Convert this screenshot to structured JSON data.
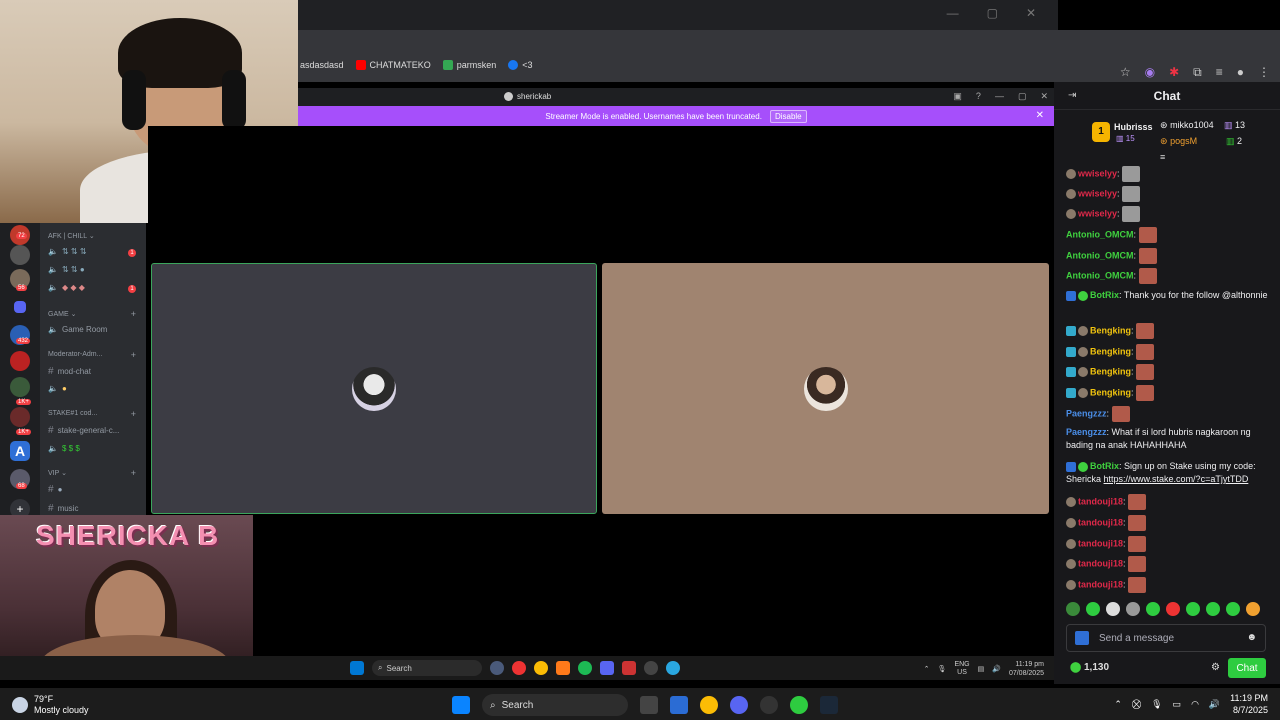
{
  "bookmarks": [
    {
      "label": "asdasdasd",
      "color": "#35363a"
    },
    {
      "label": "CHATMATEKO",
      "color": "#ff0000"
    },
    {
      "label": "parmsken",
      "color": "#34a853"
    },
    {
      "label": "<3",
      "color": "#1877f2"
    }
  ],
  "discord": {
    "window_title": "sherickab",
    "streamer_mode_text": "Streamer Mode is enabled. Usernames have been truncated.",
    "disable_label": "Disable",
    "categories": {
      "afk": "AFK | CHILL",
      "game": "GAME",
      "moderator": "Moderator-Adm...",
      "stake": "STAKE#1",
      "vip": "VIP"
    },
    "channels": {
      "game_room": "Game Room",
      "mod_chat": "mod-chat",
      "stake_general": "stake-general-c...",
      "music": "music"
    },
    "guild_badges": [
      "72",
      "56",
      "432",
      "1K+",
      "1K+",
      "68"
    ]
  },
  "overlay_name": "SHERICKA B",
  "inner_taskbar": {
    "search_label": "Search",
    "lang": "ENG",
    "region": "US",
    "time": "11:19 pm",
    "date": "07/08/2025"
  },
  "chat": {
    "title": "Chat",
    "leaderboard": {
      "rank": "1",
      "top_user": "Hubrisss",
      "top_count": "15",
      "second_user": "mikko1004",
      "second_count": "13",
      "third_user": "pogsM",
      "third_count": "2"
    },
    "messages": [
      {
        "user": "wwiselyy",
        "text": ":",
        "color": "#e0294a"
      },
      {
        "user": "wwiselyy",
        "text": ":",
        "color": "#e0294a"
      },
      {
        "user": "wwiselyy",
        "text": ":",
        "color": "#e0294a"
      },
      {
        "user": "Antonio_OMCM",
        "text": ":",
        "color": "#3fd13f"
      },
      {
        "user": "Antonio_OMCM",
        "text": ":",
        "color": "#3fd13f"
      },
      {
        "user": "Antonio_OMCM",
        "text": ":",
        "color": "#3fd13f"
      },
      {
        "user": "BotRix",
        "text": ": Thank you for the follow @althonnie",
        "color": "#3fd13f"
      },
      {
        "user": "Bengking",
        "text": ":",
        "color": "#f1c40f"
      },
      {
        "user": "Bengking",
        "text": ":",
        "color": "#f1c40f"
      },
      {
        "user": "Bengking",
        "text": ":",
        "color": "#f1c40f"
      },
      {
        "user": "Bengking",
        "text": ":",
        "color": "#f1c40f"
      },
      {
        "user": "Paengzzz",
        "text": ":",
        "color": "#4a8ee8"
      },
      {
        "user": "Paengzzz",
        "text": ": What if si lord hubris nagkaroon ng bading na anak HAHAHHAHA",
        "color": "#4a8ee8"
      },
      {
        "user": "BotRix",
        "text": ": Sign up on Stake using my code: Shericka ",
        "color": "#3fd13f",
        "link": "https://www.stake.com/?c=aTjytTDD"
      },
      {
        "user": "tandouji18",
        "text": ":",
        "color": "#e0294a"
      },
      {
        "user": "tandouji18",
        "text": ":",
        "color": "#e0294a"
      },
      {
        "user": "tandouji18",
        "text": ":",
        "color": "#e0294a"
      },
      {
        "user": "tandouji18",
        "text": ":",
        "color": "#e0294a"
      },
      {
        "user": "tandouji18",
        "text": ":",
        "color": "#e0294a"
      }
    ],
    "input_placeholder": "Send a message",
    "points": "1,130",
    "send_label": "Chat"
  },
  "taskbar": {
    "temp": "79°F",
    "condition": "Mostly cloudy",
    "search_label": "Search",
    "time": "11:19 PM",
    "date": "8/7/2025"
  }
}
